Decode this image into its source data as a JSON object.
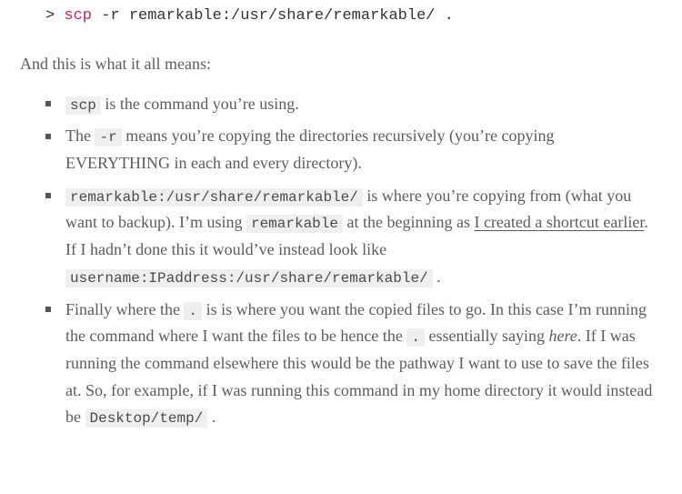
{
  "codeblock": {
    "prompt": "> ",
    "command": "scp",
    "args": " -r remarkable:/usr/share/remarkable/ ."
  },
  "intro": "And this is what it all means:",
  "items": [
    {
      "code0": "scp",
      "t0": " is the command you’re using."
    },
    {
      "t0": "The ",
      "code0": "-r",
      "t1": " means you’re copying the directories recursively (you’re copying EVERYTHING in each and every directory)."
    },
    {
      "code0": "remarkable:/usr/share/remarkable/",
      "t0": " is where you’re copying from (what you want to backup). I’m using ",
      "code1": "remarkable",
      "t1": " at the beginning as ",
      "link": "I created a shortcut earlier",
      "t2": ". If I hadn’t done this it would’ve instead look like ",
      "code2": "username:IPaddress:/usr/share/remarkable/",
      "t3": " ."
    },
    {
      "t0": "Finally where the ",
      "code0": ".",
      "t1": " is is where you want the copied files to go. In this case I’m running the command where I want the files to be hence the ",
      "code1": ".",
      "t2": " essentially saying ",
      "em": "here",
      "t3": ". If I was running the command elsewhere this would be the pathway I want to use to save the files at. So, for example, if I was running this command in my home directory it would instead be ",
      "code2": "Desktop/temp/",
      "t4": " ."
    }
  ]
}
